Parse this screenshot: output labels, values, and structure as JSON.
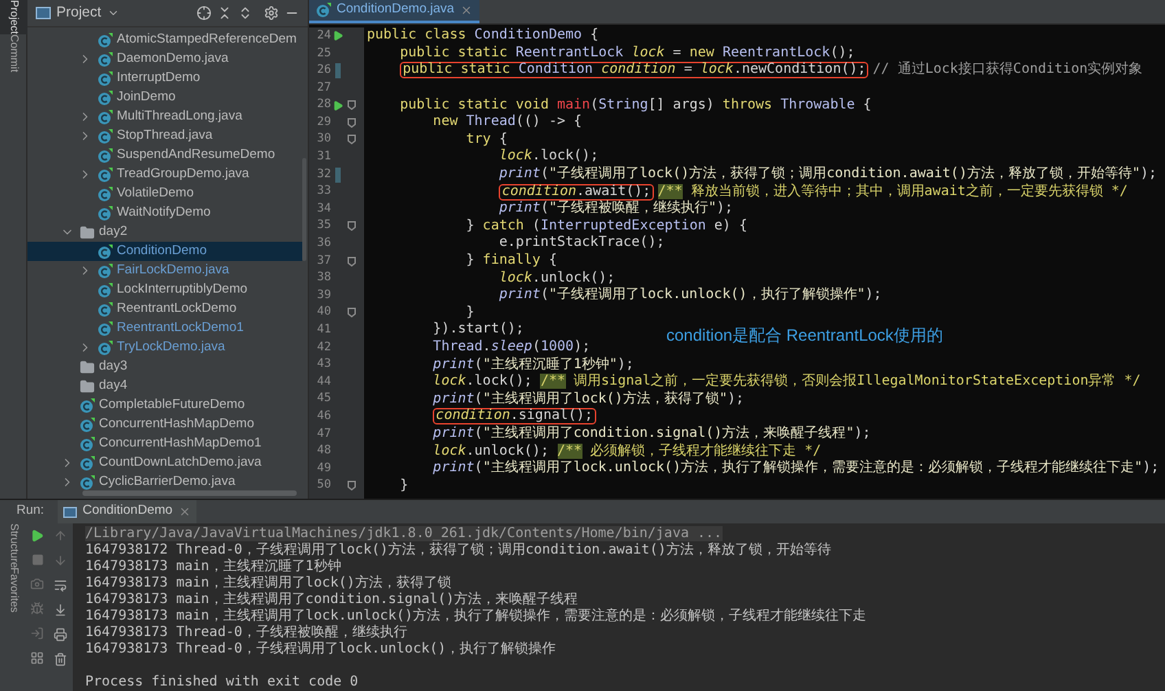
{
  "tool_windows_top": [
    {
      "label": "Project",
      "selected": true
    },
    {
      "label": "Commit",
      "selected": false
    }
  ],
  "tool_windows_bottom": [
    {
      "label": "Structure",
      "selected": false
    },
    {
      "label": "Favorites",
      "selected": false
    }
  ],
  "project": {
    "title": "Project",
    "continued_items": [
      {
        "label": "AtomicStampedReferenceDem",
        "kind": "class",
        "modified": false,
        "selected": false
      },
      {
        "label": "DaemonDemo.java",
        "kind": "class",
        "modified": false,
        "selected": false,
        "expanded": false
      },
      {
        "label": "InterruptDemo",
        "kind": "class",
        "modified": false,
        "selected": false
      },
      {
        "label": "JoinDemo",
        "kind": "class",
        "modified": false,
        "selected": false
      },
      {
        "label": "MultiThreadLong.java",
        "kind": "class",
        "modified": false,
        "selected": false,
        "expanded": false
      },
      {
        "label": "StopThread.java",
        "kind": "class",
        "modified": false,
        "selected": false,
        "expanded": false
      },
      {
        "label": "SuspendAndResumeDemo",
        "kind": "class",
        "modified": false,
        "selected": false
      },
      {
        "label": "TreadGroupDemo.java",
        "kind": "class",
        "modified": false,
        "selected": false,
        "expanded": false
      },
      {
        "label": "VolatileDemo",
        "kind": "class",
        "modified": false,
        "selected": false
      },
      {
        "label": "WaitNotifyDemo",
        "kind": "class",
        "modified": false,
        "selected": false
      }
    ],
    "items": [
      {
        "label": "day2",
        "kind": "folder",
        "modified": false,
        "selected": false,
        "expanded": true,
        "children": [
          {
            "label": "ConditionDemo",
            "kind": "class",
            "modified": true,
            "selected": true
          },
          {
            "label": "FairLockDemo.java",
            "kind": "class",
            "modified": true,
            "selected": false,
            "expanded": false
          },
          {
            "label": "LockInterruptiblyDemo",
            "kind": "class",
            "modified": false,
            "selected": false
          },
          {
            "label": "ReentrantLockDemo",
            "kind": "class",
            "modified": false,
            "selected": false
          },
          {
            "label": "ReentrantLockDemo1",
            "kind": "class",
            "modified": true,
            "selected": false
          },
          {
            "label": "TryLockDemo.java",
            "kind": "class",
            "modified": true,
            "selected": false,
            "expanded": false
          }
        ]
      },
      {
        "label": "day3",
        "kind": "folder",
        "modified": false,
        "selected": false
      },
      {
        "label": "day4",
        "kind": "folder",
        "modified": false,
        "selected": false
      },
      {
        "label": "CompletableFutureDemo",
        "kind": "class",
        "modified": false,
        "selected": false
      },
      {
        "label": "ConcurrentHashMapDemo",
        "kind": "class",
        "modified": false,
        "selected": false
      },
      {
        "label": "ConcurrentHashMapDemo1",
        "kind": "class",
        "modified": false,
        "selected": false
      },
      {
        "label": "CountDownLatchDemo.java",
        "kind": "class",
        "modified": false,
        "selected": false,
        "expanded": false
      },
      {
        "label": "CyclicBarrierDemo.java",
        "kind": "class",
        "modified": false,
        "selected": false,
        "expanded": false
      }
    ]
  },
  "editor": {
    "tab": "ConditionDemo.java",
    "annotation": "condition是配合 ReentrantLock使用的",
    "lines": [
      {
        "number": "24",
        "runnable": true,
        "changed": false,
        "fold": false,
        "parts": [
          {
            "boxed": false,
            "tokens": [
              {
                "kind": "kw",
                "text": "public class "
              },
              {
                "kind": "type",
                "text": "ConditionDemo"
              },
              {
                "kind": "plain",
                "text": " {"
              }
            ]
          }
        ]
      },
      {
        "number": "25",
        "runnable": false,
        "changed": false,
        "fold": false,
        "parts": [
          {
            "boxed": false,
            "tokens": [
              {
                "kind": "kw",
                "text": "    public static "
              },
              {
                "kind": "type",
                "text": "ReentrantLock "
              },
              {
                "kind": "field",
                "text": "lock"
              },
              {
                "kind": "plain",
                "text": " = "
              },
              {
                "kind": "kw",
                "text": "new "
              },
              {
                "kind": "type",
                "text": "ReentrantLock"
              },
              {
                "kind": "plain",
                "text": "();"
              }
            ]
          }
        ]
      },
      {
        "number": "26",
        "runnable": false,
        "changed": true,
        "fold": false,
        "parts": [
          {
            "boxed": true,
            "tokens": [
              {
                "kind": "kw",
                "text": "    public static "
              },
              {
                "kind": "type",
                "text": "Condition "
              },
              {
                "kind": "field",
                "text": "condition"
              },
              {
                "kind": "plain",
                "text": " = "
              },
              {
                "kind": "field",
                "text": "lock"
              },
              {
                "kind": "plain",
                "text": ".newCondition();"
              }
            ]
          },
          {
            "boxed": false,
            "tokens": [
              {
                "kind": "cmt",
                "text": "// 通过Lock接口获得Condition实例对象"
              }
            ]
          }
        ]
      },
      {
        "number": "27",
        "runnable": false,
        "changed": false,
        "fold": false
      },
      {
        "number": "28",
        "runnable": true,
        "changed": false,
        "fold": true,
        "parts": [
          {
            "boxed": false,
            "tokens": [
              {
                "kind": "kw",
                "text": "    public static void "
              },
              {
                "kind": "decl",
                "text": "main"
              },
              {
                "kind": "plain",
                "text": "("
              },
              {
                "kind": "type",
                "text": "String"
              },
              {
                "kind": "plain",
                "text": "[] args) "
              },
              {
                "kind": "kw",
                "text": "throws "
              },
              {
                "kind": "type",
                "text": "Throwable"
              },
              {
                "kind": "plain",
                "text": " {"
              }
            ]
          }
        ]
      },
      {
        "number": "29",
        "runnable": false,
        "changed": false,
        "fold": true,
        "parts": [
          {
            "boxed": false,
            "tokens": [
              {
                "kind": "kw",
                "text": "        new "
              },
              {
                "kind": "type",
                "text": "Thread"
              },
              {
                "kind": "plain",
                "text": "(() -> {"
              }
            ]
          }
        ]
      },
      {
        "number": "30",
        "runnable": false,
        "changed": false,
        "fold": true,
        "parts": [
          {
            "boxed": false,
            "tokens": [
              {
                "kind": "kw",
                "text": "            try"
              },
              {
                "kind": "plain",
                "text": " {"
              }
            ]
          }
        ]
      },
      {
        "number": "31",
        "runnable": false,
        "changed": false,
        "fold": false,
        "parts": [
          {
            "boxed": false,
            "tokens": [
              {
                "kind": "field",
                "text": "                lock"
              },
              {
                "kind": "plain",
                "text": ".lock();"
              }
            ]
          }
        ]
      },
      {
        "number": "32",
        "runnable": false,
        "changed": true,
        "fold": false,
        "parts": [
          {
            "boxed": false,
            "tokens": [
              {
                "kind": "static",
                "text": "                print"
              },
              {
                "kind": "plain",
                "text": "("
              },
              {
                "kind": "str",
                "text": "\"子线程调用了lock()方法，获得了锁；调用condition.await()方法，释放了锁，开始等待\""
              },
              {
                "kind": "plain",
                "text": ");"
              }
            ]
          }
        ]
      },
      {
        "number": "33",
        "runnable": false,
        "changed": false,
        "fold": false,
        "parts": [
          {
            "boxed": true,
            "tokens": [
              {
                "kind": "field",
                "text": "                condition"
              },
              {
                "kind": "plain",
                "text": ".await();"
              }
            ]
          },
          {
            "boxed": false,
            "tokens": [
              {
                "kind": "docmark",
                "text": "/**"
              },
              {
                "kind": "doc",
                "text": " 释放当前锁，进入等待中；其中，调用await之前，一定要先获得锁 */"
              }
            ]
          }
        ]
      },
      {
        "number": "34",
        "runnable": false,
        "changed": false,
        "fold": false,
        "parts": [
          {
            "boxed": false,
            "tokens": [
              {
                "kind": "static",
                "text": "                print"
              },
              {
                "kind": "plain",
                "text": "("
              },
              {
                "kind": "str",
                "text": "\"子线程被唤醒，继续执行\""
              },
              {
                "kind": "plain",
                "text": ");"
              }
            ]
          }
        ]
      },
      {
        "number": "35",
        "runnable": false,
        "changed": false,
        "fold": true,
        "parts": [
          {
            "boxed": false,
            "tokens": [
              {
                "kind": "plain",
                "text": "            } "
              },
              {
                "kind": "kw",
                "text": "catch"
              },
              {
                "kind": "plain",
                "text": " ("
              },
              {
                "kind": "type",
                "text": "InterruptedException"
              },
              {
                "kind": "plain",
                "text": " e) {"
              }
            ]
          }
        ]
      },
      {
        "number": "36",
        "runnable": false,
        "changed": false,
        "fold": false,
        "parts": [
          {
            "boxed": false,
            "tokens": [
              {
                "kind": "plain",
                "text": "                e.printStackTrace();"
              }
            ]
          }
        ]
      },
      {
        "number": "37",
        "runnable": false,
        "changed": false,
        "fold": true,
        "parts": [
          {
            "boxed": false,
            "tokens": [
              {
                "kind": "plain",
                "text": "            } "
              },
              {
                "kind": "kw",
                "text": "finally"
              },
              {
                "kind": "plain",
                "text": " {"
              }
            ]
          }
        ]
      },
      {
        "number": "38",
        "runnable": false,
        "changed": false,
        "fold": false,
        "parts": [
          {
            "boxed": false,
            "tokens": [
              {
                "kind": "field",
                "text": "                lock"
              },
              {
                "kind": "plain",
                "text": ".unlock();"
              }
            ]
          }
        ]
      },
      {
        "number": "39",
        "runnable": false,
        "changed": false,
        "fold": false,
        "parts": [
          {
            "boxed": false,
            "tokens": [
              {
                "kind": "static",
                "text": "                print"
              },
              {
                "kind": "plain",
                "text": "("
              },
              {
                "kind": "str",
                "text": "\"子线程调用了lock.unlock()，执行了解锁操作\""
              },
              {
                "kind": "plain",
                "text": ");"
              }
            ]
          }
        ]
      },
      {
        "number": "40",
        "runnable": false,
        "changed": false,
        "fold": true,
        "parts": [
          {
            "boxed": false,
            "tokens": [
              {
                "kind": "plain",
                "text": "            }"
              }
            ]
          }
        ]
      },
      {
        "number": "41",
        "runnable": false,
        "changed": false,
        "fold": false,
        "parts": [
          {
            "boxed": false,
            "tokens": [
              {
                "kind": "plain",
                "text": "        }).start();"
              }
            ]
          }
        ]
      },
      {
        "number": "42",
        "runnable": false,
        "changed": false,
        "fold": false,
        "parts": [
          {
            "boxed": false,
            "tokens": [
              {
                "kind": "type",
                "text": "        Thread"
              },
              {
                "kind": "plain",
                "text": "."
              },
              {
                "kind": "static",
                "text": "sleep"
              },
              {
                "kind": "plain",
                "text": "("
              },
              {
                "kind": "num",
                "text": "1000"
              },
              {
                "kind": "plain",
                "text": ");"
              }
            ]
          }
        ]
      },
      {
        "number": "43",
        "runnable": false,
        "changed": false,
        "fold": false,
        "parts": [
          {
            "boxed": false,
            "tokens": [
              {
                "kind": "static",
                "text": "        print"
              },
              {
                "kind": "plain",
                "text": "("
              },
              {
                "kind": "str",
                "text": "\"主线程沉睡了1秒钟\""
              },
              {
                "kind": "plain",
                "text": ");"
              }
            ]
          }
        ]
      },
      {
        "number": "44",
        "runnable": false,
        "changed": false,
        "fold": false,
        "parts": [
          {
            "boxed": false,
            "tokens": [
              {
                "kind": "field",
                "text": "        lock"
              },
              {
                "kind": "plain",
                "text": ".lock(); "
              },
              {
                "kind": "docmark",
                "text": "/**"
              },
              {
                "kind": "doc",
                "text": " 调用signal之前，一定要先获得锁，否则会报IllegalMonitorStateException异常 */"
              }
            ]
          }
        ]
      },
      {
        "number": "45",
        "runnable": false,
        "changed": false,
        "fold": false,
        "parts": [
          {
            "boxed": false,
            "tokens": [
              {
                "kind": "static",
                "text": "        print"
              },
              {
                "kind": "plain",
                "text": "("
              },
              {
                "kind": "str",
                "text": "\"主线程调用了lock()方法，获得了锁\""
              },
              {
                "kind": "plain",
                "text": ");"
              }
            ]
          }
        ]
      },
      {
        "number": "46",
        "runnable": false,
        "changed": false,
        "fold": false,
        "parts": [
          {
            "boxed": true,
            "tokens": [
              {
                "kind": "field",
                "text": "        condition"
              },
              {
                "kind": "plain",
                "text": ".signal();"
              }
            ]
          }
        ]
      },
      {
        "number": "47",
        "runnable": false,
        "changed": false,
        "fold": false,
        "parts": [
          {
            "boxed": false,
            "tokens": [
              {
                "kind": "static",
                "text": "        print"
              },
              {
                "kind": "plain",
                "text": "("
              },
              {
                "kind": "str",
                "text": "\"主线程调用了condition.signal()方法，来唤醒子线程\""
              },
              {
                "kind": "plain",
                "text": ");"
              }
            ]
          }
        ]
      },
      {
        "number": "48",
        "runnable": false,
        "changed": false,
        "fold": false,
        "parts": [
          {
            "boxed": false,
            "tokens": [
              {
                "kind": "field",
                "text": "        lock"
              },
              {
                "kind": "plain",
                "text": ".unlock(); "
              },
              {
                "kind": "docmark",
                "text": "/**"
              },
              {
                "kind": "doc",
                "text": " 必须解锁，子线程才能继续往下走 */"
              }
            ]
          }
        ]
      },
      {
        "number": "49",
        "runnable": false,
        "changed": false,
        "fold": false,
        "parts": [
          {
            "boxed": false,
            "tokens": [
              {
                "kind": "static",
                "text": "        print"
              },
              {
                "kind": "plain",
                "text": "("
              },
              {
                "kind": "str",
                "text": "\"主线程调用了lock.unlock()方法，执行了解锁操作，需要注意的是：必须解锁，子线程才能继续往下走\""
              },
              {
                "kind": "plain",
                "text": ");"
              }
            ]
          }
        ]
      },
      {
        "number": "50",
        "runnable": false,
        "changed": false,
        "fold": true,
        "parts": [
          {
            "boxed": false,
            "tokens": [
              {
                "kind": "plain",
                "text": "    }"
              }
            ]
          }
        ]
      }
    ]
  },
  "run": {
    "label": "Run:",
    "tab": "ConditionDemo",
    "command": "/Library/Java/JavaVirtualMachines/jdk1.8.0_261.jdk/Contents/Home/bin/java ...",
    "output": [
      "1647938172 Thread-0，子线程调用了lock()方法，获得了锁；调用condition.await()方法，释放了锁，开始等待",
      "1647938173 main，主线程沉睡了1秒钟",
      "1647938173 main，主线程调用了lock()方法，获得了锁",
      "1647938173 main，主线程调用了condition.signal()方法，来唤醒子线程",
      "1647938173 main，主线程调用了lock.unlock()方法，执行了解锁操作，需要注意的是：必须解锁，子线程才能继续往下走",
      "1647938173 Thread-0，子线程被唤醒，继续执行",
      "1647938173 Thread-0，子线程调用了lock.unlock()，执行了解锁操作"
    ],
    "exit_message": "Process finished with exit code 0"
  }
}
